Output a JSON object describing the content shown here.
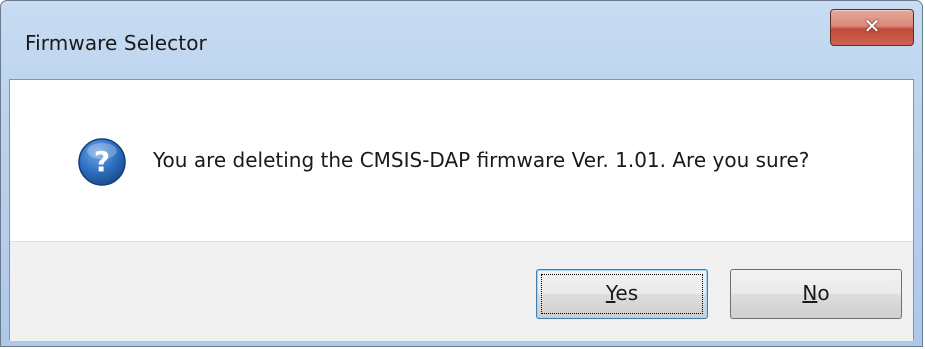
{
  "window": {
    "title": "Firmware Selector",
    "close_icon": "close-icon"
  },
  "dialog": {
    "icon": "question-icon",
    "message": "You are deleting the CMSIS-DAP firmware Ver. 1.01. Are you sure?"
  },
  "buttons": {
    "yes": {
      "mnemonic": "Y",
      "rest": "es"
    },
    "no": {
      "mnemonic": "N",
      "rest": "o"
    }
  },
  "colors": {
    "accent": "#3c7fb1",
    "close_red": "#c2493a",
    "question_blue": "#1f5fa8"
  }
}
